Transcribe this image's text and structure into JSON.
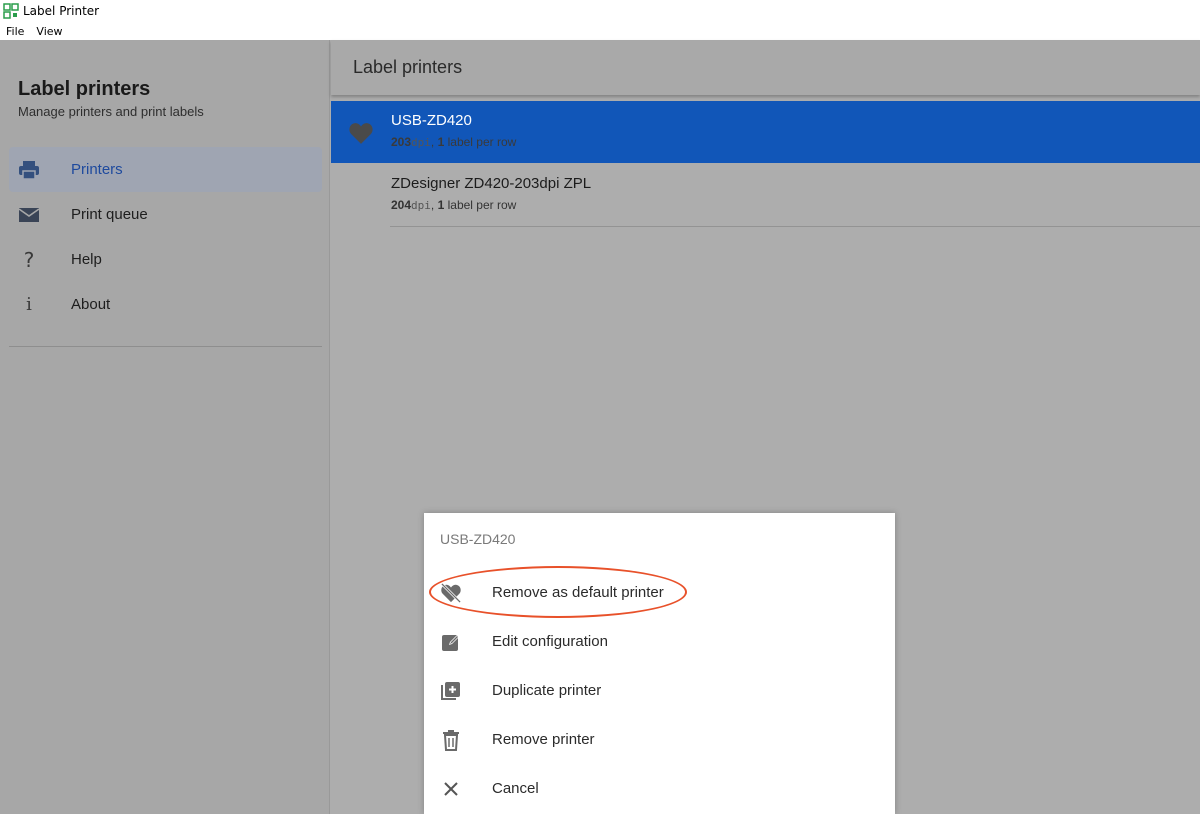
{
  "window": {
    "title": "Label Printer"
  },
  "menubar": {
    "items": [
      "File",
      "View"
    ]
  },
  "sidebar": {
    "title": "Label printers",
    "subtitle": "Manage printers and print labels",
    "items": [
      {
        "label": "Printers",
        "icon": "printer-icon",
        "active": true
      },
      {
        "label": "Print queue",
        "icon": "mail-icon",
        "active": false
      },
      {
        "label": "Help",
        "icon": "question-icon",
        "active": false
      },
      {
        "label": "About",
        "icon": "info-icon",
        "active": false
      }
    ]
  },
  "main": {
    "title": "Label printers",
    "printers": [
      {
        "name": "USB-ZD420",
        "dpi": "203",
        "dpi_unit": "dpi",
        "labels": "1",
        "labels_suffix": " label per row",
        "default": true
      },
      {
        "name": "ZDesigner ZD420-203dpi ZPL",
        "dpi": "204",
        "dpi_unit": "dpi",
        "labels": "1",
        "labels_suffix": " label per row",
        "default": false
      }
    ]
  },
  "dialog": {
    "title": "USB-ZD420",
    "items": [
      {
        "label": "Remove as default printer",
        "icon": "heart-off-icon"
      },
      {
        "label": "Edit configuration",
        "icon": "edit-icon"
      },
      {
        "label": "Duplicate printer",
        "icon": "duplicate-icon"
      },
      {
        "label": "Remove printer",
        "icon": "trash-icon"
      },
      {
        "label": "Cancel",
        "icon": "close-icon"
      }
    ]
  },
  "colors": {
    "selected_row": "#1156b8",
    "active_nav_text": "#1e4a9e",
    "highlight": "#e8512a"
  }
}
